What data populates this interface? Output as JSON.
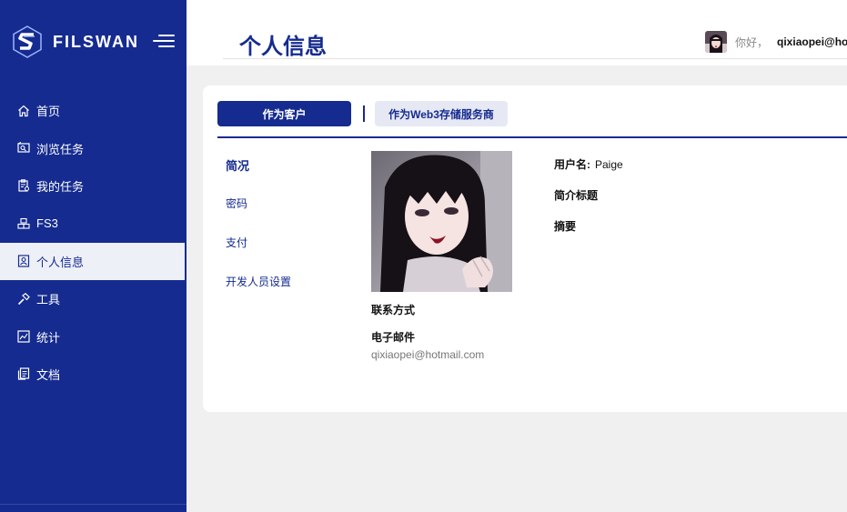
{
  "brand": {
    "name": "FILSWAN"
  },
  "sidebar": {
    "items": [
      {
        "label": "首页",
        "icon": "home-icon"
      },
      {
        "label": "浏览任务",
        "icon": "browse-icon"
      },
      {
        "label": "我的任务",
        "icon": "tasks-icon"
      },
      {
        "label": "FS3",
        "icon": "storage-icon"
      },
      {
        "label": "个人信息",
        "icon": "profile-icon",
        "active": true
      },
      {
        "label": "工具",
        "icon": "tools-icon"
      },
      {
        "label": "统计",
        "icon": "stats-icon"
      },
      {
        "label": "文档",
        "icon": "docs-icon"
      }
    ]
  },
  "header": {
    "title": "个人信息",
    "greeting": "你好，",
    "username": "qixiaopei@hotm"
  },
  "tabs": {
    "customer": "作为客户",
    "provider": "作为Web3存储服务商"
  },
  "subnav": [
    "简况",
    "密码",
    "支付",
    "开发人员设置"
  ],
  "profile": {
    "username_label": "用户名:",
    "username_value": "Paige",
    "bio_title_label": "简介标题",
    "summary_label": "摘要",
    "contact_title": "联系方式",
    "email_label": "电子邮件",
    "email_value": "qixiaopei@hotmail.com"
  },
  "colors": {
    "primary": "#152b8f",
    "accent_light": "#e6e9f4",
    "background": "#f0f0f0"
  }
}
